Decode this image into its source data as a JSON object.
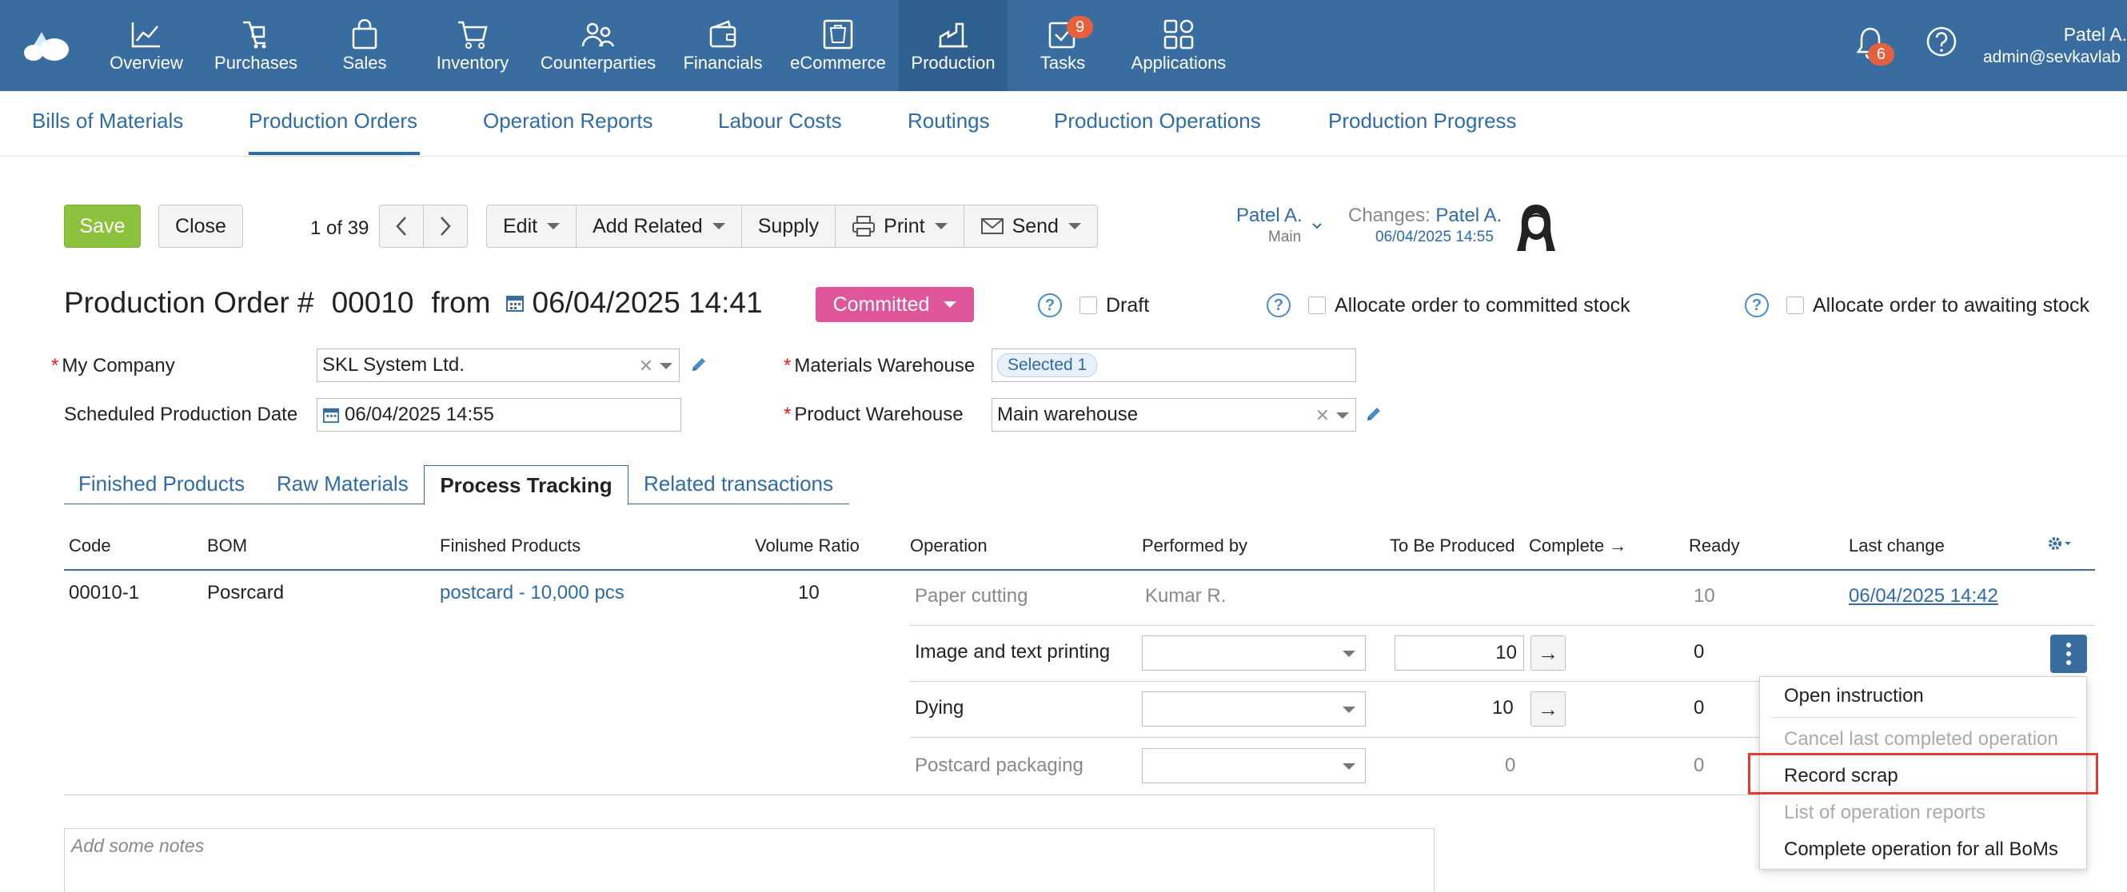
{
  "nav": {
    "items": [
      {
        "label": "Overview",
        "icon": "chart-line-icon"
      },
      {
        "label": "Purchases",
        "icon": "purchases-icon"
      },
      {
        "label": "Sales",
        "icon": "shopping-bag-icon"
      },
      {
        "label": "Inventory",
        "icon": "cart-icon"
      },
      {
        "label": "Counterparties",
        "icon": "people-icon"
      },
      {
        "label": "Financials",
        "icon": "wallet-icon"
      },
      {
        "label": "eCommerce",
        "icon": "storefront-icon"
      },
      {
        "label": "Production",
        "icon": "factory-icon"
      },
      {
        "label": "Tasks",
        "icon": "checkbox-icon"
      },
      {
        "label": "Applications",
        "icon": "grid-icon"
      }
    ],
    "tasks_badge": "9",
    "notifications_badge": "6",
    "user_name": "Patel A.",
    "user_email": "admin@sevkavlab"
  },
  "subnav": {
    "tabs": [
      "Bills of Materials",
      "Production Orders",
      "Operation Reports",
      "Labour Costs",
      "Routings",
      "Production Operations",
      "Production Progress"
    ]
  },
  "toolbar": {
    "save": "Save",
    "close": "Close",
    "pager": "1 of 39",
    "edit": "Edit",
    "add_related": "Add Related",
    "supply": "Supply",
    "print": "Print",
    "send": "Send"
  },
  "owner": {
    "name": "Patel A.",
    "department": "Main",
    "changes_label": "Changes:",
    "changes_user": "Patel A.",
    "changes_date": "06/04/2025 14:55"
  },
  "order": {
    "title_prefix": "Production Order #",
    "number": "00010",
    "from": "from",
    "date": "06/04/2025 14:41",
    "status": "Committed",
    "draft_label": "Draft",
    "allocate_committed": "Allocate order to committed stock",
    "allocate_awaiting": "Allocate order to awaiting stock"
  },
  "form": {
    "my_company_label": "My Company",
    "my_company_value": "SKL System Ltd.",
    "scheduled_date_label": "Scheduled Production Date",
    "scheduled_date_value": "06/04/2025 14:55",
    "materials_warehouse_label": "Materials Warehouse",
    "materials_warehouse_value": "Selected 1",
    "product_warehouse_label": "Product Warehouse",
    "product_warehouse_value": "Main warehouse"
  },
  "detail_tabs": [
    "Finished Products",
    "Raw Materials",
    "Process Tracking",
    "Related transactions"
  ],
  "table": {
    "headers": {
      "code": "Code",
      "bom": "BOM",
      "finished_products": "Finished Products",
      "volume_ratio": "Volume Ratio",
      "operation": "Operation",
      "performed_by": "Performed by",
      "to_be_produced": "To Be Produced",
      "complete": "Complete →",
      "ready": "Ready",
      "last_change": "Last change"
    },
    "row": {
      "code": "00010-1",
      "bom": "Posrcard",
      "finished_products": "postcard - 10,000 pcs",
      "volume_ratio": "10"
    },
    "operations": [
      {
        "name": "Paper cutting",
        "performed_by": "Kumar R.",
        "to_be_produced": "",
        "ready": "10",
        "last_change": "06/04/2025 14:42"
      },
      {
        "name": "Image and text printing",
        "performed_by": "",
        "to_be_produced": "10",
        "ready": "0",
        "last_change": ""
      },
      {
        "name": "Dying",
        "performed_by": "",
        "to_be_produced": "10",
        "ready": "0",
        "last_change": ""
      },
      {
        "name": "Postcard packaging",
        "performed_by": "",
        "to_be_produced": "0",
        "ready": "0",
        "last_change": ""
      }
    ]
  },
  "menu": {
    "items": [
      "Open instruction",
      "Cancel last completed operation",
      "Record scrap",
      "List of operation reports",
      "Complete operation for all BoMs"
    ]
  },
  "notes": {
    "placeholder": "Add some notes"
  },
  "colors": {
    "topbar": "#3a6d9f",
    "accent": "#2e6ba8",
    "save": "#8dc23e",
    "status": "#e0569a",
    "badge": "#e4603e",
    "highlight": "#e03c31"
  }
}
